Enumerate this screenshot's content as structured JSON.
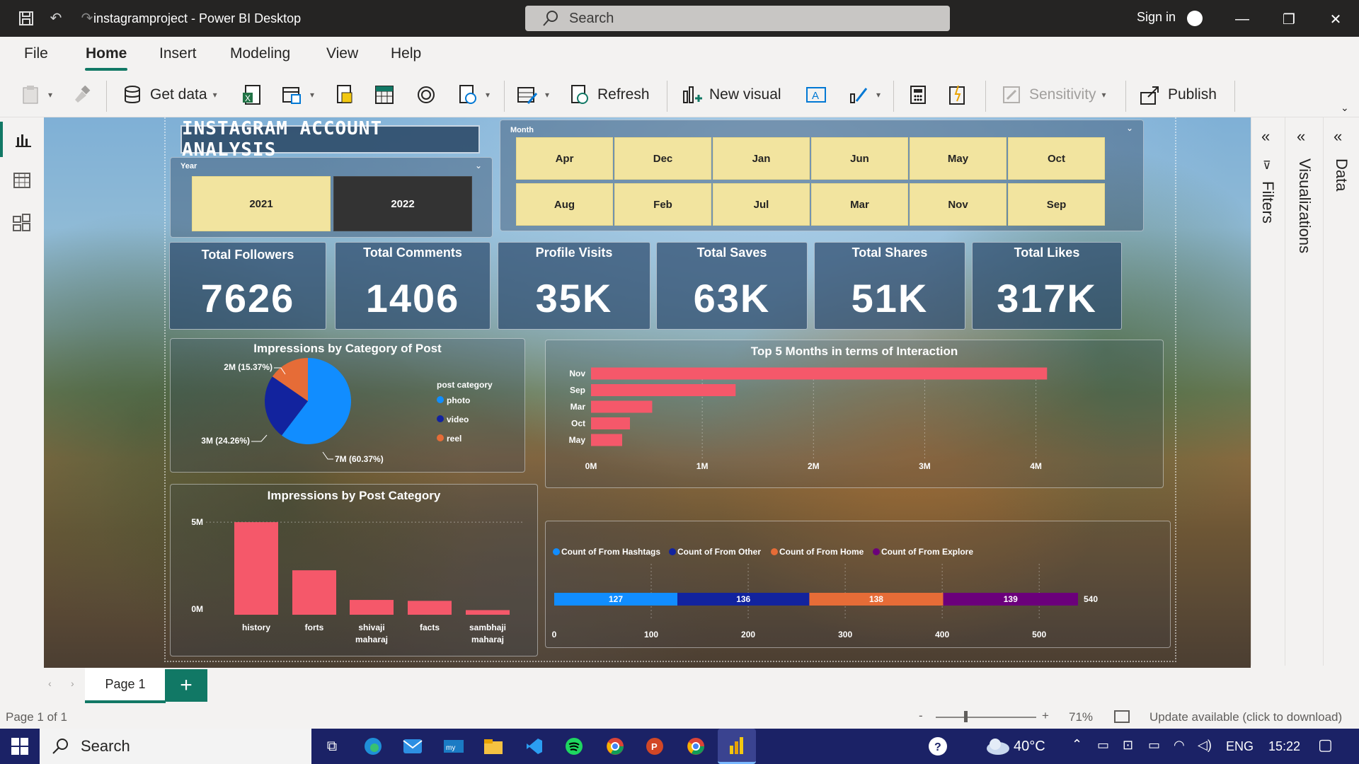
{
  "window": {
    "title": "instagramproject - Power BI Desktop",
    "search_placeholder": "Search",
    "sign_in": "Sign in"
  },
  "menu": {
    "items": [
      "File",
      "Home",
      "Insert",
      "Modeling",
      "View",
      "Help"
    ],
    "active": "Home"
  },
  "ribbon": {
    "get_data": "Get data",
    "refresh": "Refresh",
    "new_visual": "New visual",
    "sensitivity": "Sensitivity",
    "publish": "Publish"
  },
  "report": {
    "title": "INSTAGRAM ACCOUNT ANALYSIS",
    "year_slicer": {
      "label": "Year",
      "options": [
        "2021",
        "2022"
      ],
      "selected": "2022"
    },
    "month_slicer": {
      "label": "Month",
      "row1": [
        "Apr",
        "Dec",
        "Jan",
        "Jun",
        "May",
        "Oct"
      ],
      "row2": [
        "Aug",
        "Feb",
        "Jul",
        "Mar",
        "Nov",
        "Sep"
      ]
    },
    "kpis": [
      {
        "label": "Total Followers",
        "value": "7626"
      },
      {
        "label": "Total Comments",
        "value": "1406"
      },
      {
        "label": "Profile Visits",
        "value": "35K"
      },
      {
        "label": "Total Saves",
        "value": "63K"
      },
      {
        "label": "Total Shares",
        "value": "51K"
      },
      {
        "label": "Total Likes",
        "value": "317K"
      }
    ]
  },
  "colors": {
    "photo": "#118dff",
    "video": "#12239e",
    "reel": "#e66c37",
    "explore": "#6b007b",
    "bar": "#f5586a",
    "accent": "#117865",
    "slicer": "#f2e49f"
  },
  "chart_data": [
    {
      "type": "pie",
      "title": "Impressions by Category of Post",
      "legend_title": "post category",
      "legend_position": "right",
      "categories": [
        "photo",
        "video",
        "reel"
      ],
      "values": [
        60.37,
        24.26,
        15.37
      ],
      "data_labels": [
        "7M (60.37%)",
        "3M (24.26%)",
        "2M (15.37%)"
      ]
    },
    {
      "type": "bar",
      "orientation": "horizontal",
      "title": "Top 5 Months in terms of Interaction",
      "categories": [
        "Nov",
        "Sep",
        "Mar",
        "Oct",
        "May"
      ],
      "values": [
        4.1,
        1.3,
        0.55,
        0.35,
        0.28
      ],
      "x_ticks": [
        "0M",
        "1M",
        "2M",
        "3M",
        "4M"
      ],
      "xlim": [
        0,
        4.2
      ]
    },
    {
      "type": "bar",
      "title": "Impressions by Post Category",
      "categories": [
        "history",
        "forts",
        "shivaji maharaj",
        "facts",
        "sambhaji maharaj"
      ],
      "values": [
        5.0,
        2.4,
        0.8,
        0.75,
        0.25
      ],
      "y_ticks": [
        "0M",
        "5M"
      ],
      "ylim": [
        0,
        5.5
      ]
    },
    {
      "type": "bar",
      "orientation": "horizontal",
      "stacked": true,
      "legend_position": "top-left",
      "series": [
        {
          "name": "Count of From Hashtags",
          "values": [
            127
          ]
        },
        {
          "name": "Count of From Other",
          "values": [
            136
          ]
        },
        {
          "name": "Count of From Home",
          "values": [
            138
          ]
        },
        {
          "name": "Count of From Explore",
          "values": [
            139
          ]
        }
      ],
      "total_label": "540",
      "x_ticks": [
        "0",
        "100",
        "200",
        "300",
        "400",
        "500"
      ],
      "xlim": [
        0,
        540
      ]
    }
  ],
  "pages": {
    "current": "Page 1",
    "add": "+",
    "status": "Page 1 of 1"
  },
  "status": {
    "zoom": "71%",
    "update": "Update available (click to download)",
    "zoom_minus": "-",
    "zoom_plus": "+"
  },
  "panes": {
    "filters": "Filters",
    "visualizations": "Visualizations",
    "data": "Data"
  },
  "taskbar": {
    "search": "Search",
    "weather": "40°C",
    "lang": "ENG",
    "time": "15:22"
  }
}
